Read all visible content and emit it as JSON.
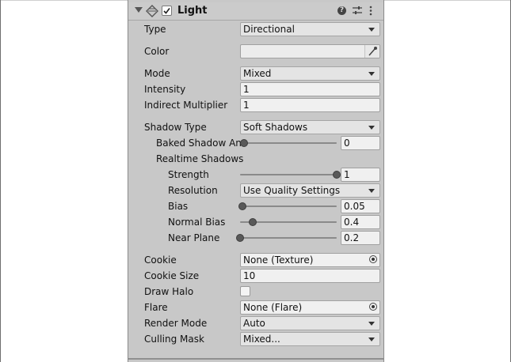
{
  "component": {
    "title": "Light",
    "enabled": true
  },
  "fields": {
    "type": {
      "label": "Type",
      "value": "Directional"
    },
    "color": {
      "label": "Color"
    },
    "mode": {
      "label": "Mode",
      "value": "Mixed"
    },
    "intensity": {
      "label": "Intensity",
      "value": "1"
    },
    "indirect_multiplier": {
      "label": "Indirect Multiplier",
      "value": "1"
    },
    "shadow_type": {
      "label": "Shadow Type",
      "value": "Soft Shadows"
    },
    "baked_shadow_angle": {
      "label": "Baked Shadow An",
      "value": "0",
      "level": 0.0
    },
    "realtime_shadows": {
      "label": "Realtime Shadows"
    },
    "strength": {
      "label": "Strength",
      "value": "1",
      "level": 1.0
    },
    "resolution": {
      "label": "Resolution",
      "value": "Use Quality Settings"
    },
    "bias": {
      "label": "Bias",
      "value": "0.05",
      "level": 0.025
    },
    "normal_bias": {
      "label": "Normal Bias",
      "value": "0.4",
      "level": 0.13
    },
    "near_plane": {
      "label": "Near Plane",
      "value": "0.2",
      "level": 0.0
    },
    "cookie": {
      "label": "Cookie",
      "value": "None (Texture)"
    },
    "cookie_size": {
      "label": "Cookie Size",
      "value": "10"
    },
    "draw_halo": {
      "label": "Draw Halo",
      "checked": false
    },
    "flare": {
      "label": "Flare",
      "value": "None (Flare)"
    },
    "render_mode": {
      "label": "Render Mode",
      "value": "Auto"
    },
    "culling_mask": {
      "label": "Culling Mask",
      "value": "Mixed..."
    }
  },
  "icons": {
    "foldout": "triangle-down-icon",
    "component": "light-icon",
    "help": "help-icon",
    "presets": "presets-icon",
    "menu": "kebab-menu-icon",
    "eyedropper": "eyedropper-icon",
    "object_picker": "object-picker-icon"
  },
  "colors": {
    "panel": "#c8c8c8",
    "field": "#f0f0f0",
    "dropdown": "#e4e4e4",
    "color_swatch": "#ececec"
  }
}
